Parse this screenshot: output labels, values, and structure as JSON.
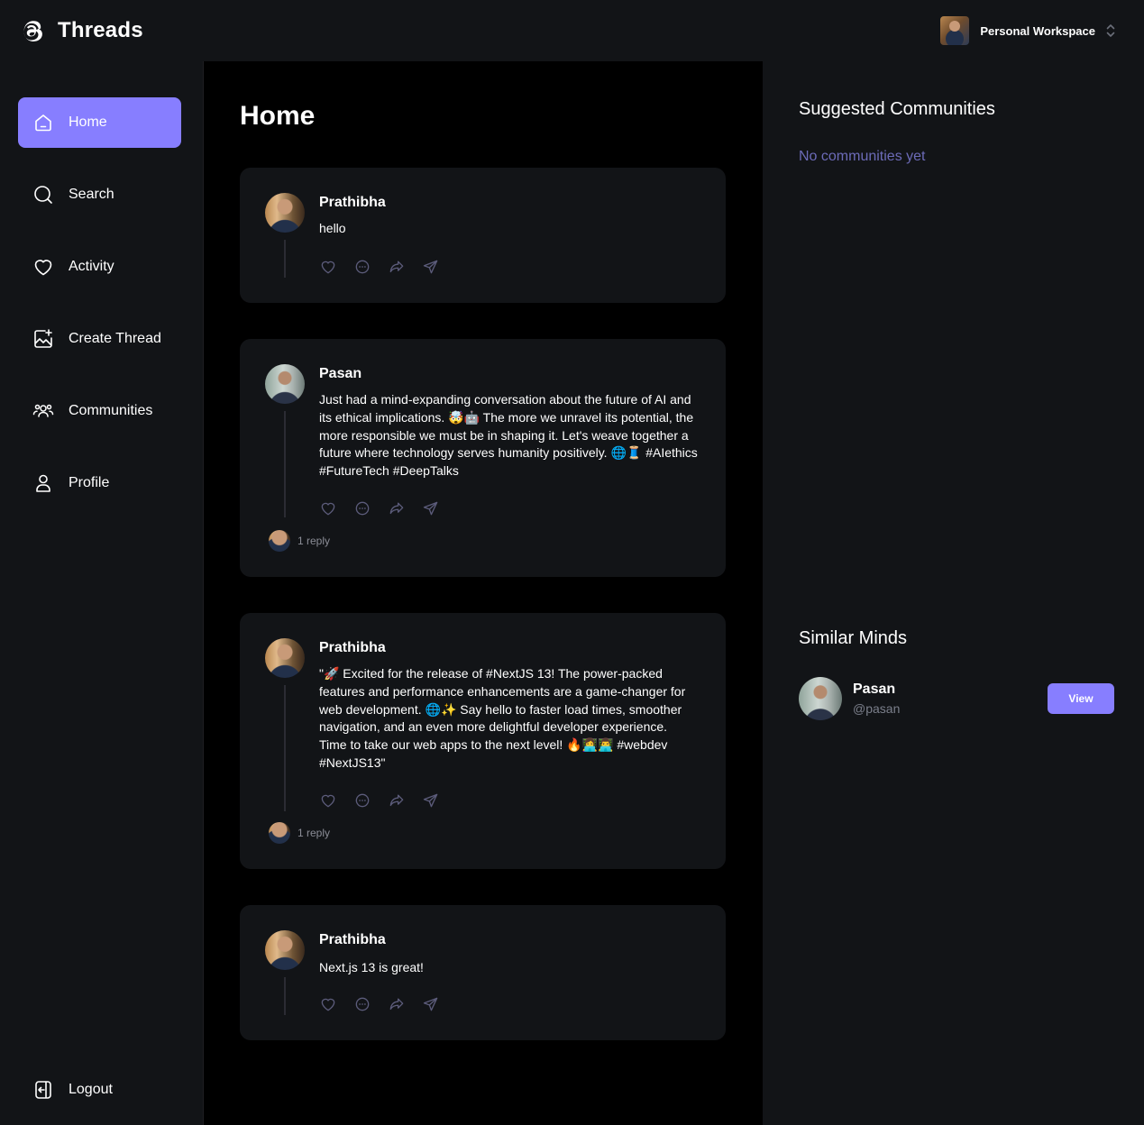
{
  "app": {
    "name": "Threads"
  },
  "workspace": {
    "label": "Personal Workspace"
  },
  "nav": {
    "items": [
      {
        "label": "Home",
        "icon": "home-icon"
      },
      {
        "label": "Search",
        "icon": "search-icon"
      },
      {
        "label": "Activity",
        "icon": "heart-icon"
      },
      {
        "label": "Create Thread",
        "icon": "create-thread-icon"
      },
      {
        "label": "Communities",
        "icon": "communities-icon"
      },
      {
        "label": "Profile",
        "icon": "profile-icon"
      }
    ],
    "active": "Home",
    "logout": {
      "label": "Logout",
      "icon": "logout-icon"
    }
  },
  "main": {
    "title": "Home",
    "threads": [
      {
        "author": "Prathibha",
        "text": "hello",
        "replies": ""
      },
      {
        "author": "Pasan",
        "text": "Just had a mind-expanding conversation about the future of AI and its ethical implications. 🤯🤖 The more we unravel its potential, the more responsible we must be in shaping it. Let's weave together a future where technology serves humanity positively. 🌐🧵 #AIethics #FutureTech #DeepTalks",
        "replies": "1 reply"
      },
      {
        "author": "Prathibha",
        "text": "\"🚀 Excited for the release of #NextJS 13! The power-packed features and performance enhancements are a game-changer for web development. 🌐✨ Say hello to faster load times, smoother navigation, and an even more delightful developer experience. Time to take our web apps to the next level! 🔥👩‍💻👨‍💻 #webdev #NextJS13\"",
        "replies": "1 reply"
      },
      {
        "author": "Prathibha",
        "text": "Next.js 13 is great!",
        "replies": ""
      }
    ]
  },
  "sidebar_right": {
    "suggested_title": "Suggested Communities",
    "suggested_empty": "No communities yet",
    "similar_title": "Similar Minds",
    "similar": [
      {
        "name": "Pasan",
        "handle": "@pasan",
        "button": "View"
      }
    ]
  },
  "colors": {
    "accent": "#877eff",
    "panel": "#121417",
    "page": "#000000",
    "muted": "#6c6bb8"
  }
}
